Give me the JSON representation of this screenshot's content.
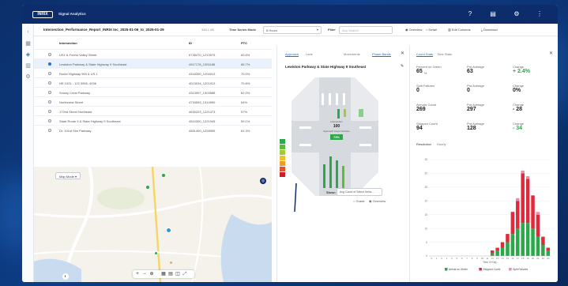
{
  "topbar": {
    "logo": "INRIX",
    "title": "Signal Analytics"
  },
  "toolbar": {
    "filename": "Intersection_Performance_Report_INRIX Inc_2025-01-06_to_2025-01-29",
    "filesize": "348.1 kB",
    "time_label": "Time Series Mode",
    "time_value": "8 Hours",
    "filter_label": "Filter",
    "filter_placeholder": "Any Search",
    "opt_overview": "Overview",
    "opt_detail": "Detail",
    "opt_columns": "Edit Columns",
    "opt_download": "Download"
  },
  "list": {
    "headers": {
      "name": "Intersection",
      "id": "ID",
      "pct": "PTC"
    },
    "rows": [
      {
        "name": "US1 & Forest Valley Street",
        "id": "6738470_1213975",
        "pct": "65.6%",
        "selected": false
      },
      {
        "name": "Lewiston Parkway & State Highway 9 Southeast",
        "id": "4917178_1351188",
        "pct": "65.7%",
        "selected": true
      },
      {
        "name": "Route Highway 903 & US 1",
        "id": "4318390_1204013",
        "pct": "70.0%",
        "selected": false
      },
      {
        "name": "HE 1031 - 122 3955, 4036",
        "id": "4013034_1201913",
        "pct": "70.8%",
        "selected": false
      },
      {
        "name": "Snowy Crest Parkway",
        "id": "4313907_1303588",
        "pct": "62.0%",
        "selected": false
      },
      {
        "name": "Northcrest Street",
        "id": "4734593_1314990",
        "pct": "64%",
        "selected": false
      },
      {
        "name": "172nd Street Northeast",
        "id": "4630223_1221473",
        "pct": "57%",
        "selected": false
      },
      {
        "name": "State Route 9 & State Highway 9 Southeast",
        "id": "4510300_1221945",
        "pct": "59.1%",
        "selected": false
      },
      {
        "name": "Dr. 101st Sim Parkway",
        "id": "4551400_1228905",
        "pct": "61.3%",
        "selected": false
      }
    ]
  },
  "map": {
    "style_label": "Map Mode"
  },
  "intersection": {
    "tabs": [
      "Approach",
      "Lane",
      "Movements",
      "Phase Bands"
    ],
    "active_tab": 2,
    "title": "Lewiston Parkway & State Highway 9 Southeast",
    "center_label": "Intersection",
    "center_count": "100",
    "center_sub": "Approach Count Vehicles",
    "center_pct": "73%",
    "show_label": "Show:",
    "show_value": "Avg Count of Select Vehic...",
    "legend_grade": "Grade",
    "legend_overview": "Overview",
    "grade_colors": [
      "#2aa84a",
      "#5dbb3b",
      "#a6c93a",
      "#f0c22a",
      "#f39b2a",
      "#e2532d",
      "#c8202a"
    ]
  },
  "stats": {
    "tabs": [
      "Count Stats",
      "Time Stats"
    ],
    "items": [
      {
        "label": "Percent on Green",
        "value": "65",
        "unit": "%",
        "avg_label": "Prd Average",
        "avg": "63",
        "avg_unit": "%",
        "change_label": "Change",
        "change": "+ 2.4%",
        "change_color": "#2aa84a"
      },
      {
        "label": "Split Failures",
        "value": "0",
        "unit": "",
        "avg_label": "Prd Average",
        "avg": "0",
        "avg_unit": "",
        "change_label": "Change",
        "change": "0%",
        "change_color": "#222222"
      },
      {
        "label": "Arrivals Count",
        "value": "269",
        "unit": "",
        "avg_label": "Prd Average",
        "avg": "297",
        "avg_unit": "",
        "change_label": "Change",
        "change": "- 28",
        "change_color": "#222222"
      },
      {
        "label": "Stopped Count",
        "value": "94",
        "unit": "",
        "avg_label": "Prd Average",
        "avg": "128",
        "avg_unit": "",
        "change_label": "Change",
        "change": "- 34",
        "change_color": "#2aa84a"
      }
    ],
    "chart_tabs": [
      "Resolution",
      "Hourly"
    ]
  },
  "chart_data": {
    "type": "bar",
    "stacked": true,
    "title": "",
    "xlabel": "Time Of Day",
    "ylabel": "",
    "categories": [
      "0",
      "1",
      "2",
      "3",
      "4",
      "5",
      "6",
      "7",
      "8",
      "9",
      "10",
      "11",
      "12",
      "13",
      "14",
      "15",
      "16",
      "17",
      "18",
      "19",
      "20",
      "21",
      "22",
      "23"
    ],
    "ylim": [
      0,
      35
    ],
    "yticks": [
      0,
      5,
      10,
      15,
      20,
      25,
      30,
      35
    ],
    "series": [
      {
        "name": "Arrival on Green",
        "color": "#2aa84a",
        "values": [
          0,
          0,
          0,
          0,
          0,
          0,
          0,
          0,
          0,
          0,
          0,
          0,
          1,
          2,
          3,
          5,
          8,
          10,
          12,
          12,
          10,
          7,
          4,
          2
        ]
      },
      {
        "name": "Stopped Count",
        "color": "#e0293a",
        "values": [
          0,
          0,
          0,
          0,
          0,
          0,
          0,
          0,
          0,
          0,
          0,
          0,
          1,
          1,
          2,
          3,
          8,
          10,
          18,
          16,
          12,
          8,
          3,
          1
        ]
      },
      {
        "name": "Split Failures",
        "color": "#f08bb0",
        "values": [
          0,
          0,
          0,
          0,
          0,
          0,
          0,
          0,
          0,
          0,
          0,
          0,
          0,
          0,
          0,
          0,
          0,
          1,
          1,
          1,
          0,
          1,
          0,
          0
        ]
      }
    ],
    "legend_position": "bottom"
  }
}
